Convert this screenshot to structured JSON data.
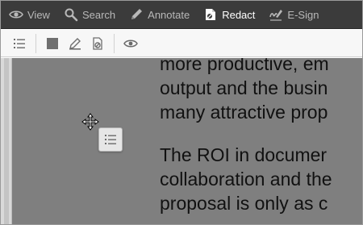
{
  "toolbar": {
    "tabs": [
      {
        "label": "View",
        "icon": "eye-icon",
        "active": false
      },
      {
        "label": "Search",
        "icon": "search-icon",
        "active": false
      },
      {
        "label": "Annotate",
        "icon": "pen-icon",
        "active": false
      },
      {
        "label": "Redact",
        "icon": "redact-icon",
        "active": true
      },
      {
        "label": "E-Sign",
        "icon": "signature-icon",
        "active": false
      }
    ]
  },
  "redact_toolbar": {
    "buttons": [
      "list-icon",
      "redact-area-icon",
      "redact-draw-icon",
      "redact-clear-icon",
      "eye-icon"
    ]
  },
  "document": {
    "lines_top": [
      "more productive, em",
      "output and the busin",
      "many attractive prop"
    ],
    "lines_bottom": [
      "The ROI in documer",
      "collaboration and the",
      "proposal is only as c"
    ]
  },
  "colors": {
    "toolbar_bg": "#3b3b3b",
    "active_tab_text": "#ffffff",
    "inactive_tab_text": "#b8b8b8",
    "redaction_overlay": "#7f7f7f"
  }
}
